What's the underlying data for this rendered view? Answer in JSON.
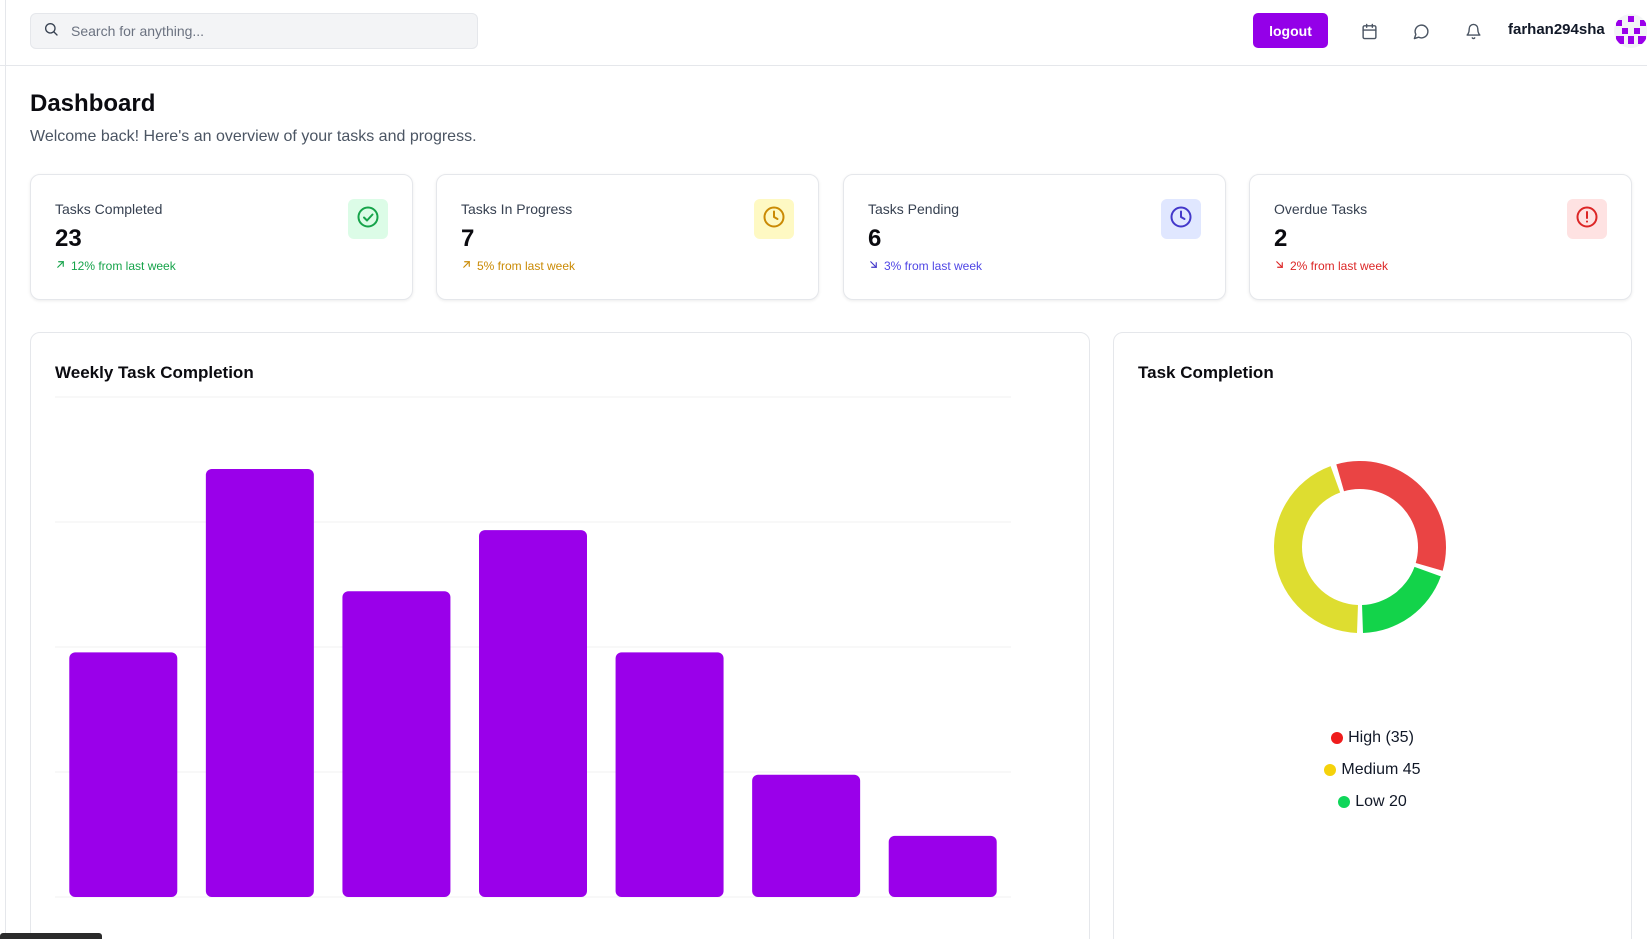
{
  "search": {
    "placeholder": "Search for anything..."
  },
  "topbar": {
    "logout_label": "logout",
    "username": "farhan294sha"
  },
  "icons": [
    "search-icon",
    "calendar-icon",
    "message-icon",
    "bell-icon",
    "avatar-icon"
  ],
  "header": {
    "title": "Dashboard",
    "subtitle": "Welcome back! Here's an overview of your tasks and progress."
  },
  "stats": [
    {
      "label": "Tasks Completed",
      "value": "23",
      "trend": "12% from last week",
      "trend_color": "#16a34a",
      "badge_bg": "#dcfce7",
      "icon_color": "#16a34a",
      "icon": "check-circle-icon",
      "direction": "up"
    },
    {
      "label": "Tasks In Progress",
      "value": "7",
      "trend": "5% from last week",
      "trend_color": "#ca8a04",
      "badge_bg": "#fef9c3",
      "icon_color": "#ca8a04",
      "icon": "clock-icon",
      "direction": "up"
    },
    {
      "label": "Tasks Pending",
      "value": "6",
      "trend": "3% from last week",
      "trend_color": "#4f46e5",
      "badge_bg": "#e0e7ff",
      "icon_color": "#4338ca",
      "icon": "clock-icon",
      "direction": "down"
    },
    {
      "label": "Overdue Tasks",
      "value": "2",
      "trend": "2% from last week",
      "trend_color": "#dc2626",
      "badge_bg": "#fee2e2",
      "icon_color": "#dc2626",
      "icon": "alert-circle-icon",
      "direction": "down"
    }
  ],
  "weekly_chart": {
    "title": "Weekly Task Completion"
  },
  "completion_chart": {
    "title": "Task Completion"
  },
  "legend": [
    {
      "label": "High (35)",
      "color": "#ef1c1c"
    },
    {
      "label": "Medium 45",
      "color": "#f5d20b"
    },
    {
      "label": "Low 20",
      "color": "#0fd65a"
    }
  ],
  "colors": {
    "accent": "#9400e8",
    "bar": "#9a00ea"
  },
  "chart_data": [
    {
      "type": "bar",
      "title": "Weekly Task Completion",
      "values": [
        4,
        7,
        5,
        6,
        4,
        2,
        1
      ],
      "ylim": [
        0,
        7
      ],
      "grid": true,
      "color": "#9a00ea"
    },
    {
      "type": "pie",
      "title": "Task Completion",
      "categories": [
        "High",
        "Medium",
        "Low"
      ],
      "values": [
        35,
        45,
        20
      ],
      "colors": [
        "#ea4444",
        "#dedd30",
        "#13d34a"
      ],
      "donut": true,
      "legend": "bottom"
    }
  ]
}
